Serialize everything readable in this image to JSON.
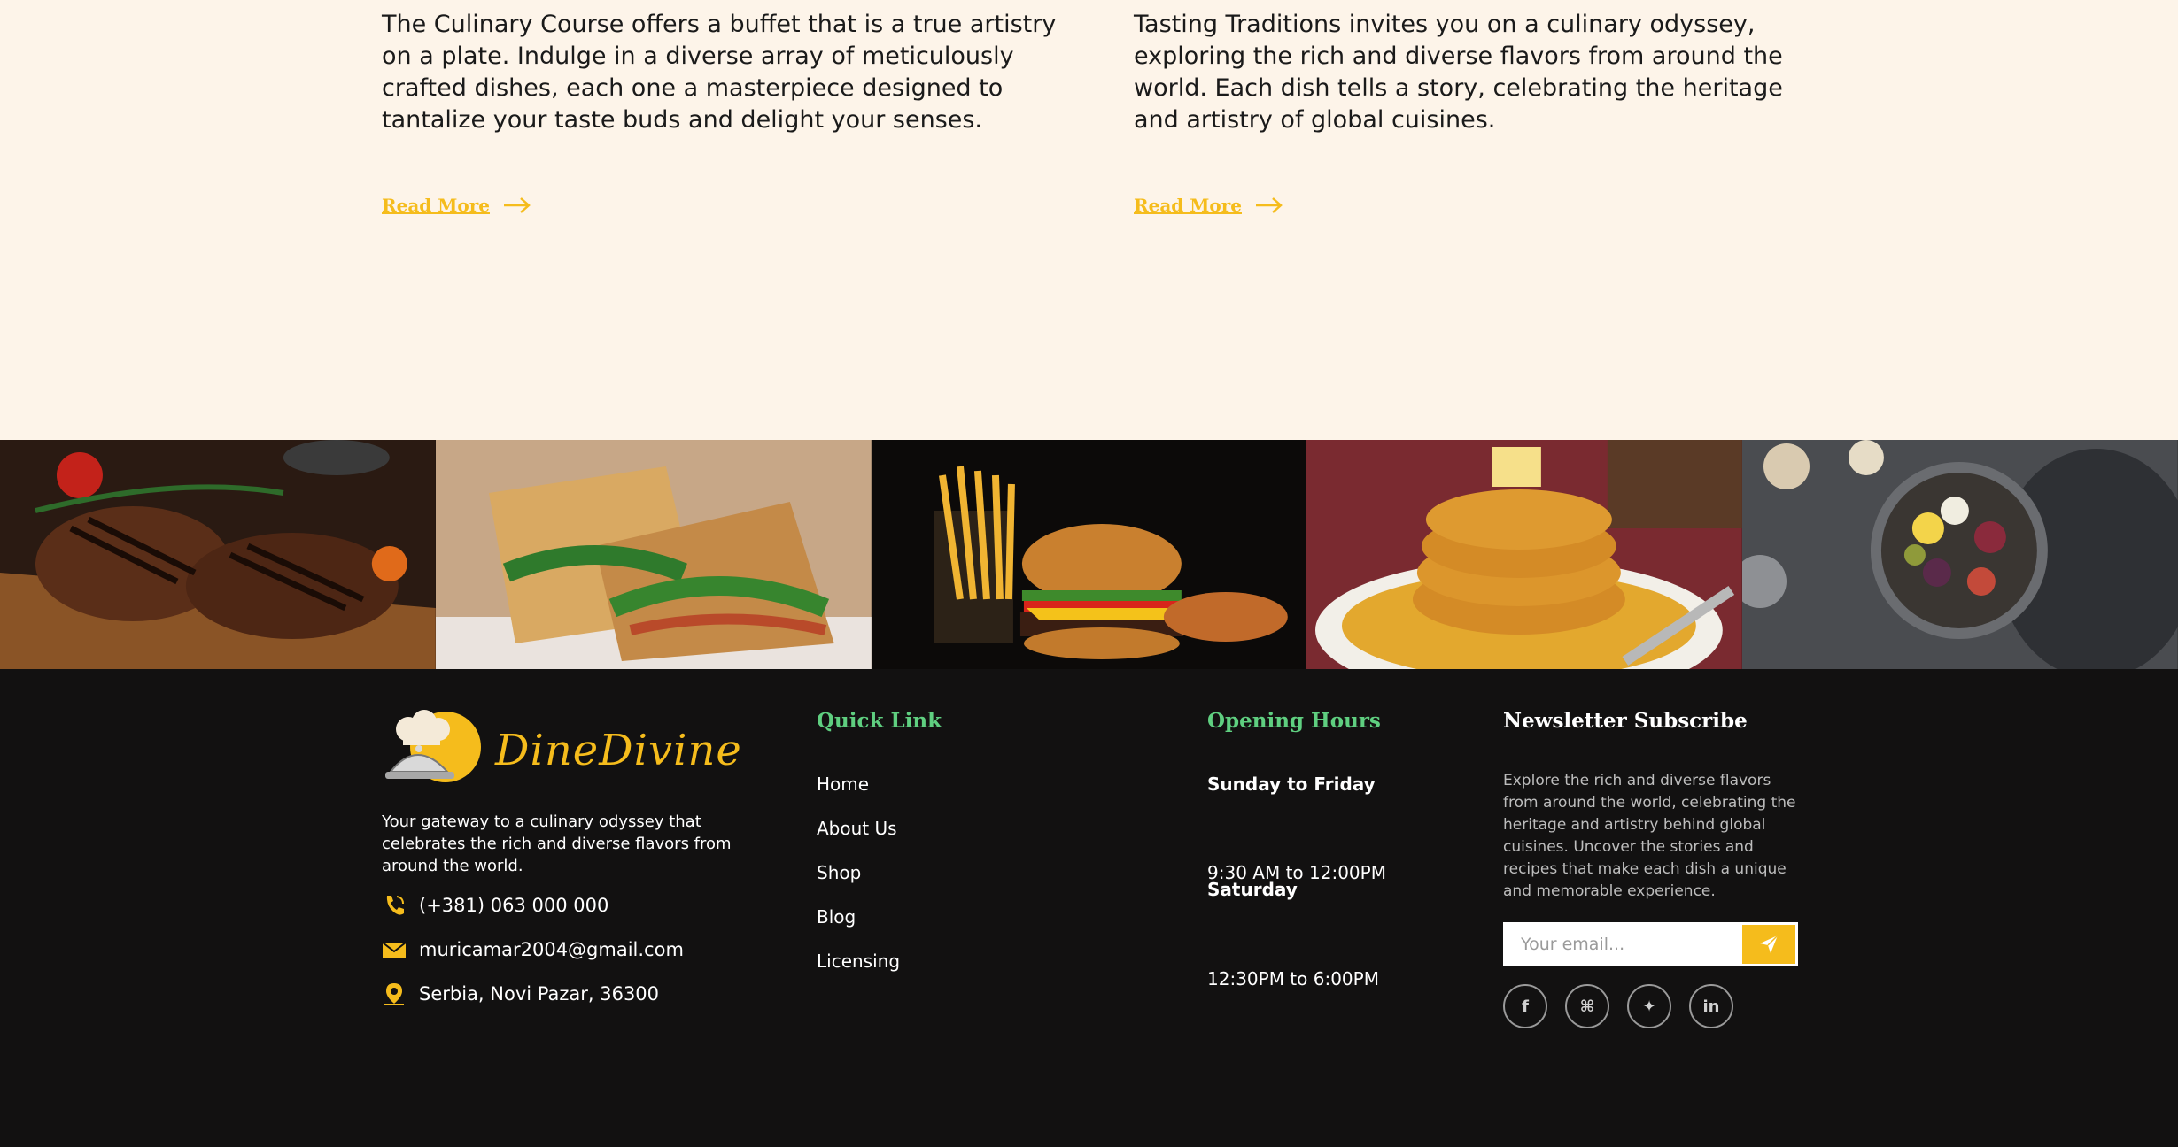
{
  "blog": {
    "cards": [
      {
        "excerpt": "The Culinary Course offers a buffet that is a true artistry on a plate. Indulge in a diverse array of meticulously crafted dishes, each one a masterpiece designed to tantalize your taste buds and delight your senses.",
        "read_more": "Read More"
      },
      {
        "excerpt": "Tasting Traditions invites you on a culinary odyssey, exploring the rich and diverse flavors from around the world. Each dish tells a story, celebrating the heritage and artistry of global cuisines.",
        "read_more": "Read More"
      }
    ]
  },
  "gallery": {
    "images": [
      {
        "icon": "grilled-steak-image"
      },
      {
        "icon": "sandwich-image"
      },
      {
        "icon": "burger-fries-image"
      },
      {
        "icon": "pancakes-image"
      },
      {
        "icon": "platter-image"
      }
    ]
  },
  "footer": {
    "logo_text": "DineDivine",
    "description": "Your gateway to a culinary odyssey that celebrates the rich and diverse flavors from around the world.",
    "phone": "(+381) 063 000 000",
    "email": "muricamar2004@gmail.com",
    "address": "Serbia, Novi Pazar, 36300",
    "quick_link_title": "Quick Link",
    "quick_links": [
      "Home",
      "About Us",
      "Shop",
      "Blog",
      "Licensing"
    ],
    "hours_title": "Opening Hours",
    "hours": {
      "days1": "Sunday to Friday",
      "time1": "9:30 AM to 12:00PM",
      "days2": "Saturday",
      "time2": "12:30PM to 6:00PM"
    },
    "newsletter_title": "Newsletter Subscribe",
    "newsletter_desc": "Explore the rich and diverse flavors from around the world, celebrating the heritage and artistry behind global cuisines. Uncover the stories and recipes that make each dish a unique and memorable experience.",
    "email_placeholder": "Your email...",
    "socials": [
      {
        "icon": "facebook-icon",
        "glyph": "f"
      },
      {
        "icon": "github-icon",
        "glyph": "⌘"
      },
      {
        "icon": "twitter-icon",
        "glyph": "✦"
      },
      {
        "icon": "linkedin-icon",
        "glyph": "in"
      }
    ],
    "colors": {
      "accent": "#f5bc1c",
      "heading_green": "#5fcf80",
      "background": "#121111",
      "cream": "#fdf4e9"
    }
  }
}
